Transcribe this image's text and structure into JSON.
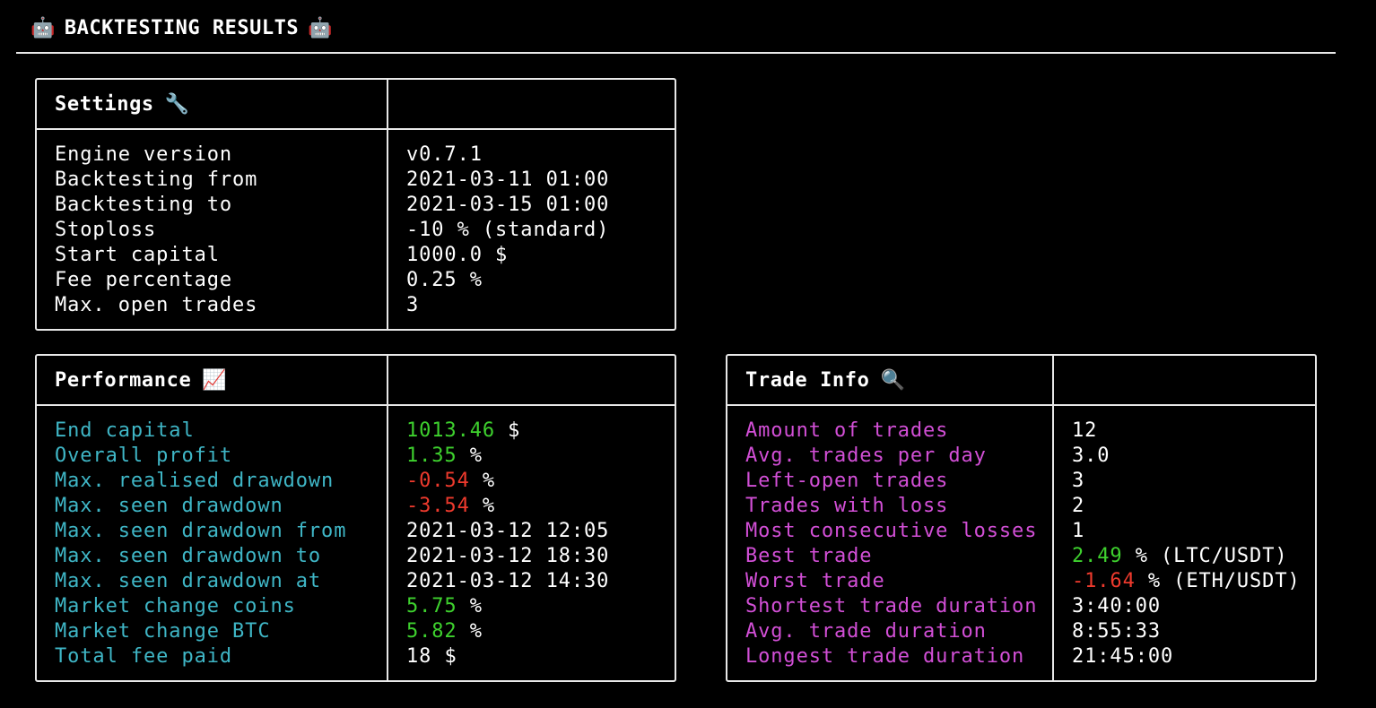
{
  "header": {
    "title": "BACKTESTING RESULTS",
    "emoji_left": "🤖",
    "emoji_right": "🤖"
  },
  "settings": {
    "title": "Settings",
    "emoji": "🔧",
    "rows": [
      {
        "key": "Engine version",
        "value": "v0.7.1"
      },
      {
        "key": "Backtesting from",
        "value": "2021-03-11 01:00"
      },
      {
        "key": "Backtesting to",
        "value": "2021-03-15 01:00"
      },
      {
        "key": "Stoploss",
        "value": "-10 % (standard)"
      },
      {
        "key": "Start capital",
        "value": "1000.0 $"
      },
      {
        "key": "Fee percentage",
        "value": "0.25 %"
      },
      {
        "key": "Max. open trades",
        "value": "3"
      }
    ]
  },
  "performance": {
    "title": "Performance",
    "emoji": "📈",
    "rows": [
      {
        "key": "End capital",
        "num": "1013.46",
        "suffix": " $",
        "color": "#3ed12e"
      },
      {
        "key": "Overall profit",
        "num": "1.35",
        "suffix": " %",
        "color": "#3ed12e"
      },
      {
        "key": "Max. realised drawdown",
        "num": "-0.54",
        "suffix": " %",
        "color": "#ee3a2d"
      },
      {
        "key": "Max. seen drawdown",
        "num": "-3.54",
        "suffix": " %",
        "color": "#ee3a2d"
      },
      {
        "key": "Max. seen drawdown from",
        "num": "2021-03-12 12:05",
        "suffix": "",
        "color": "#ffffff"
      },
      {
        "key": "Max. seen drawdown to",
        "num": "2021-03-12 18:30",
        "suffix": "",
        "color": "#ffffff"
      },
      {
        "key": "Max. seen drawdown at",
        "num": "2021-03-12 14:30",
        "suffix": "",
        "color": "#ffffff"
      },
      {
        "key": "Market change coins",
        "num": "5.75",
        "suffix": " %",
        "color": "#3ed12e"
      },
      {
        "key": "Market change BTC",
        "num": "5.82",
        "suffix": " %",
        "color": "#3ed12e"
      },
      {
        "key": "Total fee paid",
        "num": "18",
        "suffix": " $",
        "color": "#ffffff"
      }
    ]
  },
  "trade_info": {
    "title": "Trade Info",
    "emoji": "🔍",
    "rows": [
      {
        "key": "Amount of trades",
        "num": "12",
        "suffix": "",
        "color": "#ffffff"
      },
      {
        "key": "Avg. trades per day",
        "num": "3.0",
        "suffix": "",
        "color": "#ffffff"
      },
      {
        "key": "Left-open trades",
        "num": "3",
        "suffix": "",
        "color": "#ffffff"
      },
      {
        "key": "Trades with loss",
        "num": "2",
        "suffix": "",
        "color": "#ffffff"
      },
      {
        "key": "Most consecutive losses",
        "num": "1",
        "suffix": "",
        "color": "#ffffff"
      },
      {
        "key": "Best trade",
        "num": "2.49",
        "suffix": " % (LTC/USDT)",
        "color": "#3ed12e"
      },
      {
        "key": "Worst trade",
        "num": "-1.64",
        "suffix": " % (ETH/USDT)",
        "color": "#ee3a2d"
      },
      {
        "key": "Shortest trade duration",
        "num": "3:40:00",
        "suffix": "",
        "color": "#ffffff"
      },
      {
        "key": "Avg. trade duration",
        "num": "8:55:33",
        "suffix": "",
        "color": "#ffffff"
      },
      {
        "key": "Longest trade duration",
        "num": "21:45:00",
        "suffix": "",
        "color": "#ffffff"
      }
    ]
  },
  "colors": {
    "performance_key": "#3fb6c6",
    "trade_info_key": "#d24fd6",
    "positive": "#3ed12e",
    "negative": "#ee3a2d",
    "border": "#e8e8e8"
  }
}
